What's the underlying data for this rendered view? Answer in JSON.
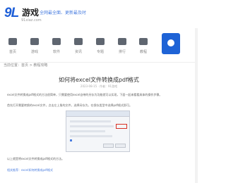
{
  "logo": {
    "mark": "9L",
    "name": "游戏",
    "subtitle": "91xiaz.com",
    "tagline": "全网最全面、更新最及时"
  },
  "nav": {
    "items": [
      {
        "label": "首页"
      },
      {
        "label": "游戏"
      },
      {
        "label": "软件"
      },
      {
        "label": "资讯"
      },
      {
        "label": "专题"
      },
      {
        "label": "排行"
      },
      {
        "label": "教程"
      }
    ]
  },
  "breadcrumb": "当前位置：首页 > 教程攻略",
  "article": {
    "title": "如何将excel文件转换成pdf格式",
    "meta": "2023-08-15 · 作者：91游戏",
    "para1": "excel文件转换成pdf格式的方法很简单，只需要使用excel自带的另存为功能就可以实现，下面一起来看看具体的操作步骤。",
    "para2": "首先打开需要转换的excel文件，点击左上角的文件，选择另存为，在保存类型中选择pdf格式即可。",
    "caption": "以上就是将excel文件转换成pdf格式的方法。",
    "link": "相关推荐：excel如何转换成pdf格式"
  },
  "colors": {
    "accent": "#1e63d6",
    "logo": "#1e5fd8"
  }
}
